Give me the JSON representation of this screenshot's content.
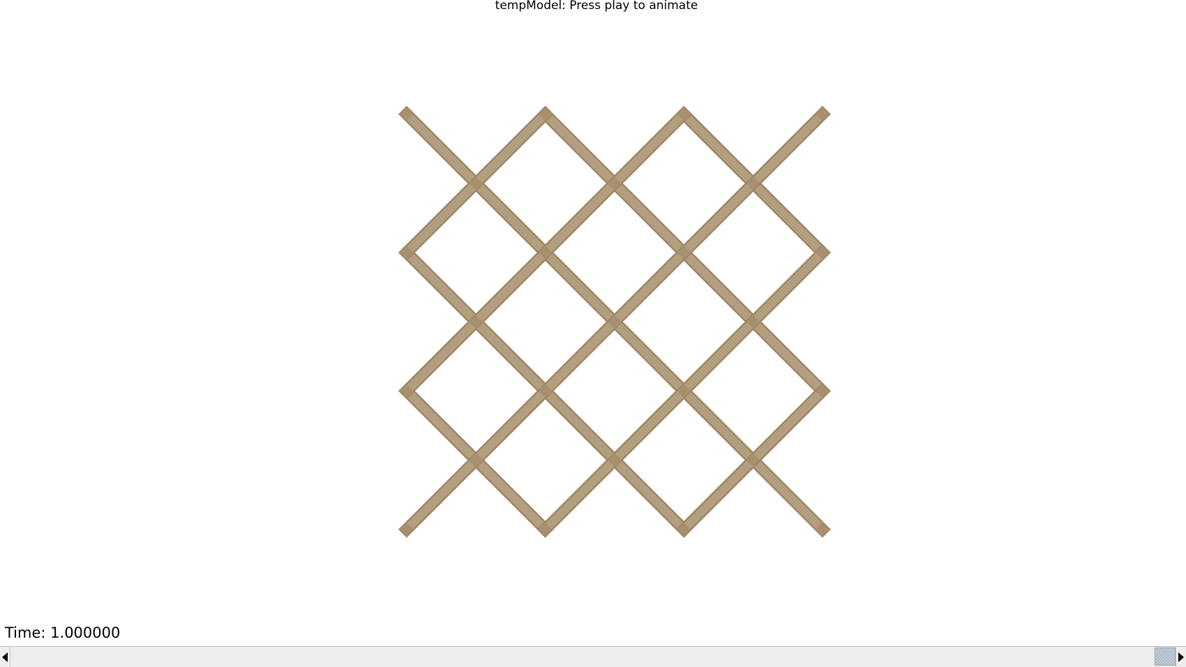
{
  "window": {
    "title": "tempModel: Press play to animate"
  },
  "status": {
    "time_label": "Time:",
    "time_value": "1.000000"
  },
  "model": {
    "name": "lattice-mesh",
    "strut_color": "#b39f7e",
    "strut_edge_color": "#9c8865",
    "node_color": "#a88f6d"
  },
  "icons": {
    "scroll_left": "triangle-left-icon",
    "scroll_right": "triangle-right-icon"
  }
}
